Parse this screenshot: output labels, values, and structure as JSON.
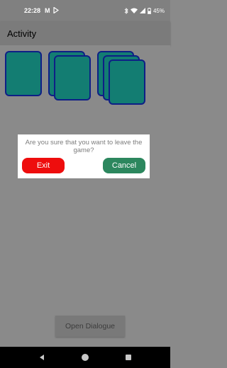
{
  "status_bar": {
    "time": "22:28",
    "notification_letter": "M",
    "battery": "45%",
    "icons": [
      "gmail-icon",
      "play-icon",
      "bluetooth-icon",
      "wifi-icon",
      "signal-icon",
      "battery-icon"
    ]
  },
  "app_bar": {
    "title": "Activity"
  },
  "cards": {
    "color": "#137d72",
    "border_color": "#0e1f86",
    "stacks": [
      1,
      2,
      3
    ]
  },
  "dialog": {
    "message": "Are you sure that you want to leave the game?",
    "exit_label": "Exit",
    "cancel_label": "Cancel",
    "exit_color": "#ee0d0d",
    "cancel_color": "#2c875e"
  },
  "open_dialog_label": "Open Dialogue",
  "nav_bar": {
    "icons": [
      "back-icon",
      "home-icon",
      "recents-icon"
    ]
  }
}
